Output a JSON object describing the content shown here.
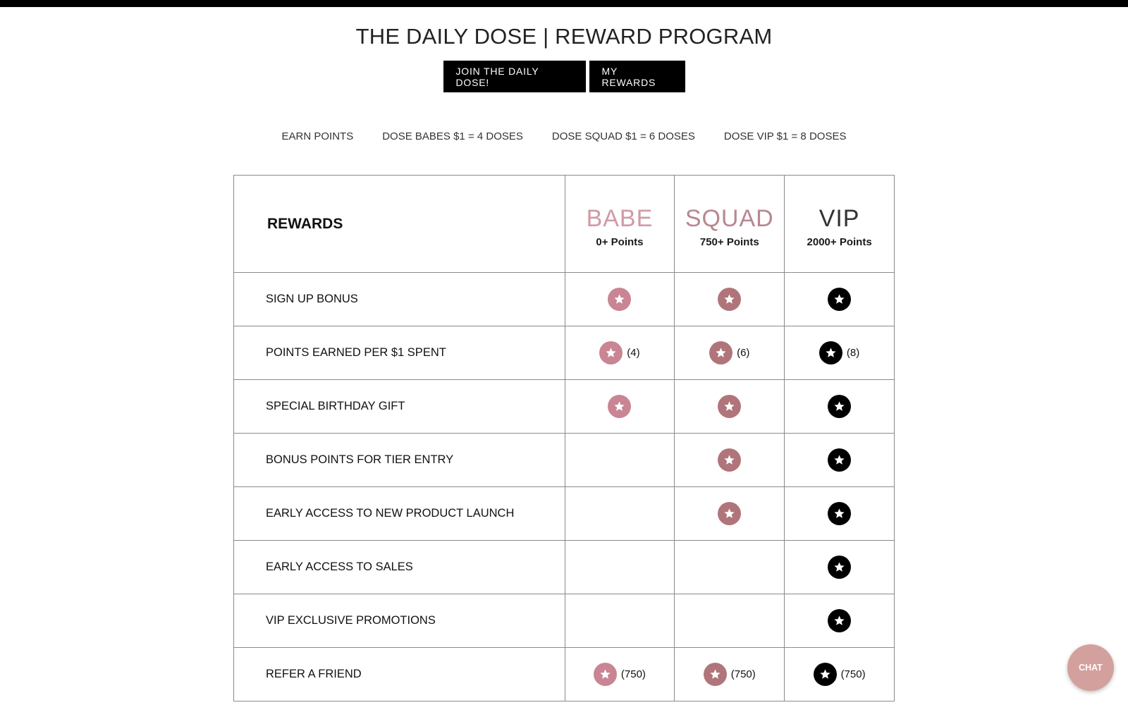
{
  "header": {
    "title": "THE DAILY DOSE | REWARD PROGRAM",
    "buttons": [
      "JOIN THE DAILY DOSE!",
      "MY REWARDS"
    ]
  },
  "tabs": [
    "EARN POINTS",
    "DOSE BABES $1 = 4 DOSES",
    "DOSE SQUAD $1 = 6 DOSES",
    "DOSE VIP $1 = 8 DOSES"
  ],
  "table": {
    "header_label": "REWARDS",
    "tiers": [
      {
        "name": "BABE",
        "points": "0+ Points",
        "color": "#d09aa6",
        "star_color": "#c98593"
      },
      {
        "name": "SQUAD",
        "points": "750+ Points",
        "color": "#b88790",
        "star_color": "#b0757a"
      },
      {
        "name": "VIP",
        "points": "2000+ Points",
        "color": "#333333",
        "star_color": "#000000"
      }
    ],
    "rows": [
      {
        "label": "SIGN UP BONUS",
        "cells": [
          {
            "star": true,
            "value": ""
          },
          {
            "star": true,
            "value": ""
          },
          {
            "star": true,
            "value": ""
          }
        ]
      },
      {
        "label": "POINTS EARNED PER $1 SPENT",
        "cells": [
          {
            "star": true,
            "value": "(4)"
          },
          {
            "star": true,
            "value": "(6)"
          },
          {
            "star": true,
            "value": "(8)"
          }
        ]
      },
      {
        "label": "SPECIAL BIRTHDAY GIFT",
        "cells": [
          {
            "star": true,
            "value": ""
          },
          {
            "star": true,
            "value": ""
          },
          {
            "star": true,
            "value": ""
          }
        ]
      },
      {
        "label": "BONUS POINTS FOR TIER ENTRY",
        "cells": [
          {
            "star": false,
            "value": ""
          },
          {
            "star": true,
            "value": ""
          },
          {
            "star": true,
            "value": ""
          }
        ]
      },
      {
        "label": "EARLY ACCESS TO NEW PRODUCT LAUNCH",
        "cells": [
          {
            "star": false,
            "value": ""
          },
          {
            "star": true,
            "value": ""
          },
          {
            "star": true,
            "value": ""
          }
        ]
      },
      {
        "label": "EARLY ACCESS TO SALES",
        "cells": [
          {
            "star": false,
            "value": ""
          },
          {
            "star": false,
            "value": ""
          },
          {
            "star": true,
            "value": ""
          }
        ]
      },
      {
        "label": "VIP EXCLUSIVE PROMOTIONS",
        "cells": [
          {
            "star": false,
            "value": ""
          },
          {
            "star": false,
            "value": ""
          },
          {
            "star": true,
            "value": ""
          }
        ]
      },
      {
        "label": "REFER A FRIEND",
        "cells": [
          {
            "star": true,
            "value": "(750)"
          },
          {
            "star": true,
            "value": "(750)"
          },
          {
            "star": true,
            "value": "(750)"
          }
        ]
      }
    ]
  },
  "chat": {
    "label": "CHAT",
    "color": "#d4a09d"
  }
}
